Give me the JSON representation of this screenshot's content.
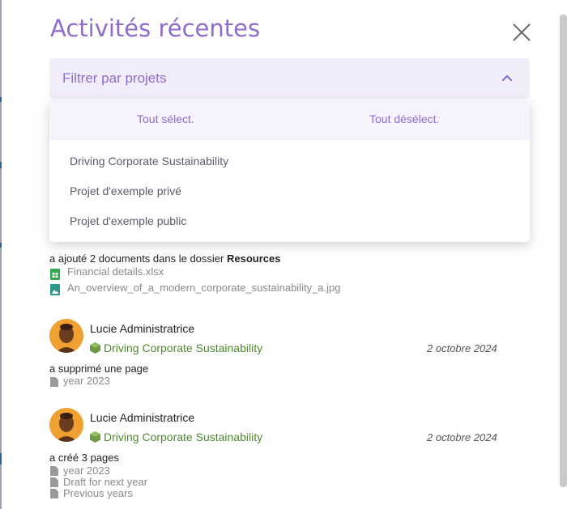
{
  "panel": {
    "title": "Activités récentes"
  },
  "filter": {
    "placeholder": "Filtrer par projets",
    "select_all": "Tout sélect.",
    "deselect_all": "Tout désélect.",
    "options": [
      "Driving Corporate Sustainability",
      "Projet d'exemple privé",
      "Projet d'exemple public"
    ]
  },
  "activities": [
    {
      "action_prefix": "a ajouté 2 documents dans le dossier ",
      "action_bold": "Resources",
      "items": [
        {
          "name": "Financial details.xlsx",
          "icon": "spreadsheet-icon"
        },
        {
          "name": "An_overview_of_a_modern_corporate_sustainability_a.jpg",
          "icon": "image-file-icon"
        }
      ]
    },
    {
      "user": "Lucie Administratrice",
      "project": "Driving Corporate Sustainability",
      "date": "2 octobre 2024",
      "action": "a supprimé une page",
      "items": [
        {
          "name": "year 2023",
          "icon": "document-icon"
        }
      ]
    },
    {
      "user": "Lucie Administratrice",
      "project": "Driving Corporate Sustainability",
      "date": "2 octobre 2024",
      "action": "a créé 3 pages",
      "items": [
        {
          "name": "year 2023",
          "icon": "document-icon"
        },
        {
          "name": "Draft for next year",
          "icon": "document-icon"
        },
        {
          "name": "Previous years",
          "icon": "document-icon"
        }
      ]
    }
  ],
  "colors": {
    "accent": "#8f6ccd",
    "project": "#4f8a2f",
    "filter_bg": "#f2edfb"
  }
}
